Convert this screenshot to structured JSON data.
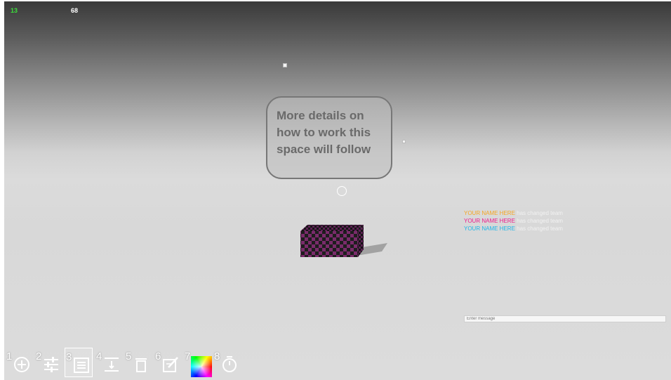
{
  "hud": {
    "fps": "13",
    "ping": "68"
  },
  "bubble": {
    "text": "More details on how to work this space will follow"
  },
  "event_log": [
    {
      "name": "YOUR NAME HERE",
      "message": " has changed team",
      "color": "#f5a623"
    },
    {
      "name": "YOUR NAME HERE",
      "message": " has changed team",
      "color": "#ec1a8b"
    },
    {
      "name": "YOUR NAME HERE",
      "message": " has changed team",
      "color": "#1fb5e8"
    }
  ],
  "chat": {
    "placeholder": "Enter message"
  },
  "toolbar": {
    "tools": [
      {
        "number": "1",
        "icon": "add-circle-icon"
      },
      {
        "number": "2",
        "icon": "sliders-icon"
      },
      {
        "number": "3",
        "icon": "text-note-icon",
        "selected": true
      },
      {
        "number": "4",
        "icon": "align-height-icon"
      },
      {
        "number": "5",
        "icon": "trash-icon"
      },
      {
        "number": "6",
        "icon": "edit-note-icon"
      },
      {
        "number": "7",
        "icon": "color-picker-icon"
      },
      {
        "number": "8",
        "icon": "timer-icon"
      }
    ]
  },
  "colors": {
    "fps": "#3be03b",
    "cube_a": "#7a2b6b",
    "cube_b": "#1e1e1e"
  }
}
